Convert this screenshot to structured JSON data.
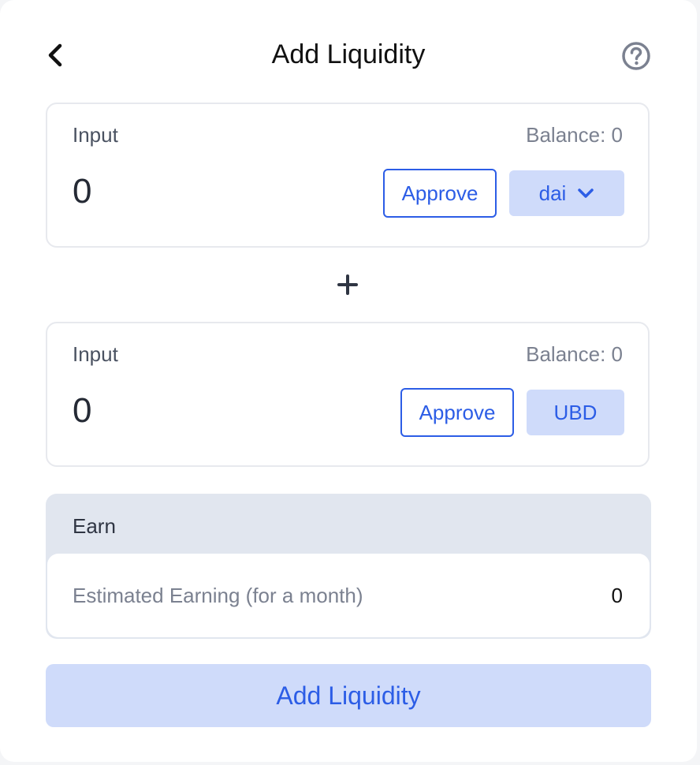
{
  "header": {
    "title": "Add Liquidity",
    "back_icon": "chevron-left-icon",
    "help_icon": "question-circle-icon"
  },
  "input_a": {
    "label": "Input",
    "balance": "Balance: 0",
    "amount": "0",
    "approve_label": "Approve",
    "token_label": "dai",
    "token_icon": "chevron-down-icon"
  },
  "separator_icon": "plus-icon",
  "input_b": {
    "label": "Input",
    "balance": "Balance: 0",
    "amount": "0",
    "approve_label": "Approve",
    "token_label": "UBD"
  },
  "earn": {
    "title": "Earn",
    "estimate_label": "Estimated Earning (for a month)",
    "estimate_value": "0"
  },
  "submit_label": "Add Liquidity",
  "colors": {
    "accent": "#2c5de6",
    "accent_light": "#cfdbfa",
    "panel": "#e1e6ef",
    "border": "#e7e9ee"
  }
}
